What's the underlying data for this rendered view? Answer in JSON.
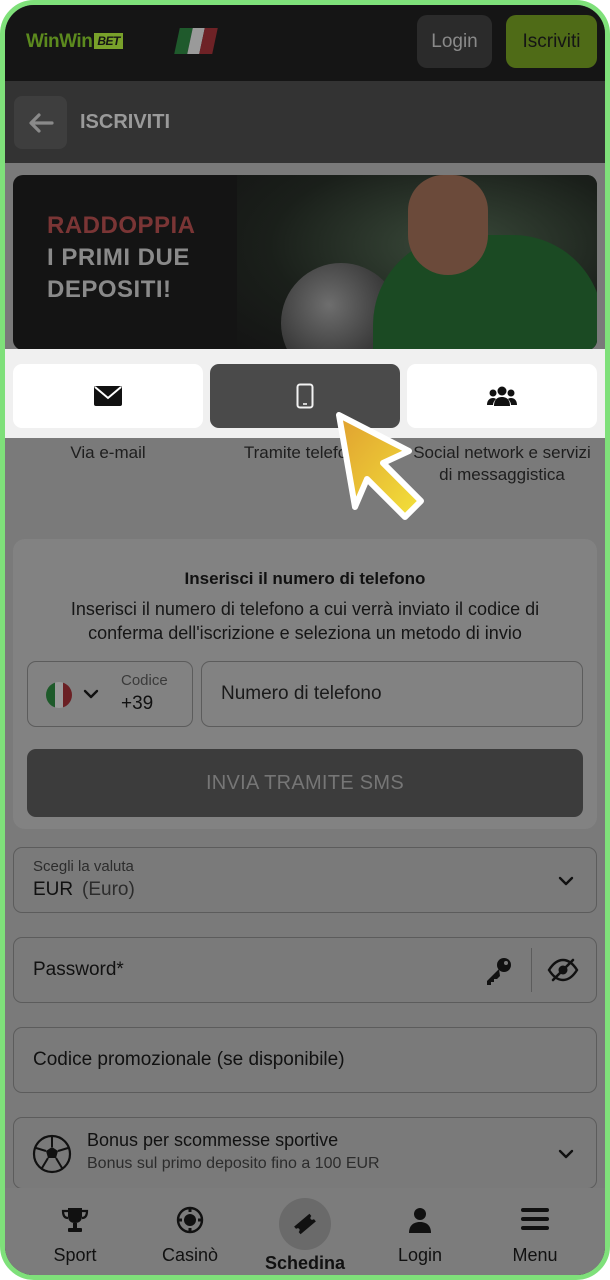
{
  "topbar": {
    "logo_text": "WinWin",
    "logo_badge": "BET",
    "login_label": "Login",
    "signup_label": "Iscriviti",
    "colors": {
      "accent": "#79a12a",
      "background": "#151515"
    }
  },
  "header": {
    "back_icon": "arrow-left-icon",
    "title": "ISCRIVITI"
  },
  "banner": {
    "line1": "RADDOPPIA",
    "line2": "I PRIMI DUE",
    "line3": "DEPOSITI!"
  },
  "methods": {
    "email": {
      "label": "Via e-mail",
      "icon": "envelope-icon"
    },
    "phone": {
      "label": "Tramite telefono",
      "icon": "mobile-phone-icon",
      "selected": true
    },
    "social": {
      "label": "Social network e servizi di messaggistica",
      "icon": "users-icon"
    }
  },
  "phone_form": {
    "title": "Inserisci il numero di telefono",
    "description": "Inserisci il numero di telefono a cui verrà inviato il codice di conferma dell'iscrizione e seleziona un metodo di invio",
    "country_code_label": "Codice",
    "country_code_value": "+39",
    "phone_placeholder": "Numero di telefono",
    "sms_button": "INVIA TRAMITE SMS"
  },
  "currency": {
    "label": "Scegli la valuta",
    "code": "EUR",
    "name": "(Euro)"
  },
  "password": {
    "placeholder": "Password*"
  },
  "promo": {
    "placeholder": "Codice promozionale (se disponibile)"
  },
  "bonus": {
    "title": "Bonus per scommesse sportive",
    "subtitle": "Bonus sul primo deposito fino a 100 EUR"
  },
  "bottom_nav": {
    "sport": "Sport",
    "casino": "Casinò",
    "betslip": "Schedina",
    "login": "Login",
    "menu": "Menu"
  }
}
